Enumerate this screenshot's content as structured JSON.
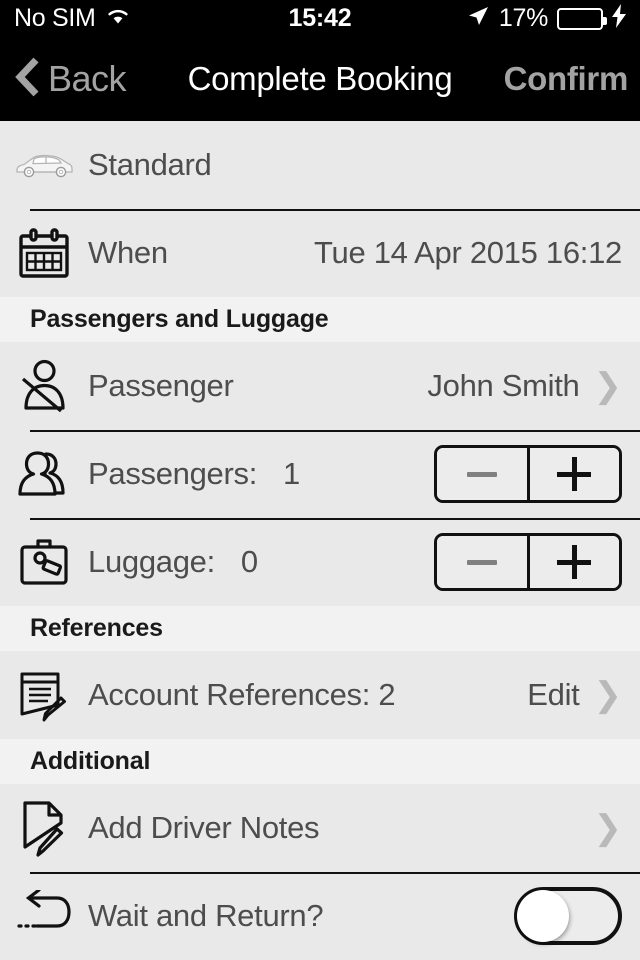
{
  "status_bar": {
    "carrier": "No SIM",
    "wifi_icon": "wifi-icon",
    "time": "15:42",
    "location_icon": "location-arrow-icon",
    "battery_percent": "17%",
    "battery_level": 17,
    "charging_icon": "lightning-bolt-icon"
  },
  "nav": {
    "back_label": "Back",
    "back_icon": "chevron-left-icon",
    "title": "Complete Booking",
    "confirm_label": "Confirm"
  },
  "vehicle": {
    "icon": "car-icon",
    "label": "Standard"
  },
  "when": {
    "icon": "calendar-icon",
    "label": "When",
    "value": "Tue 14 Apr 2015 16:12"
  },
  "sections": {
    "passengers_luggage": "Passengers and Luggage",
    "references": "References",
    "additional": "Additional"
  },
  "passenger": {
    "icon": "passenger-seatbelt-icon",
    "label": "Passenger",
    "value": "John Smith",
    "chevron": "chevron-right-icon"
  },
  "passengers_count": {
    "icon": "two-people-icon",
    "label": "Passengers:",
    "value": "1",
    "minus_label": "−",
    "plus_label": "+",
    "minus_enabled": false,
    "plus_enabled": true
  },
  "luggage_count": {
    "icon": "briefcase-icon",
    "label": "Luggage:",
    "value": "0",
    "minus_label": "−",
    "plus_label": "+",
    "minus_enabled": false,
    "plus_enabled": true
  },
  "account_references": {
    "icon": "document-pencil-icon",
    "label": "Account References: 2",
    "action_label": "Edit",
    "chevron": "chevron-right-icon"
  },
  "driver_notes": {
    "icon": "page-pencil-icon",
    "label": "Add Driver Notes",
    "chevron": "chevron-right-icon"
  },
  "wait_return": {
    "icon": "u-turn-arrow-icon",
    "label": "Wait and Return?",
    "toggle_state": "off"
  },
  "colors": {
    "nav_background": "#000000",
    "row_background": "#e9e9e9",
    "section_background": "#f2f2f2",
    "text": "#4d4d4d",
    "nav_inactive": "#a3a3a3",
    "battery_red": "#ff2d20",
    "divider": "#111111"
  }
}
